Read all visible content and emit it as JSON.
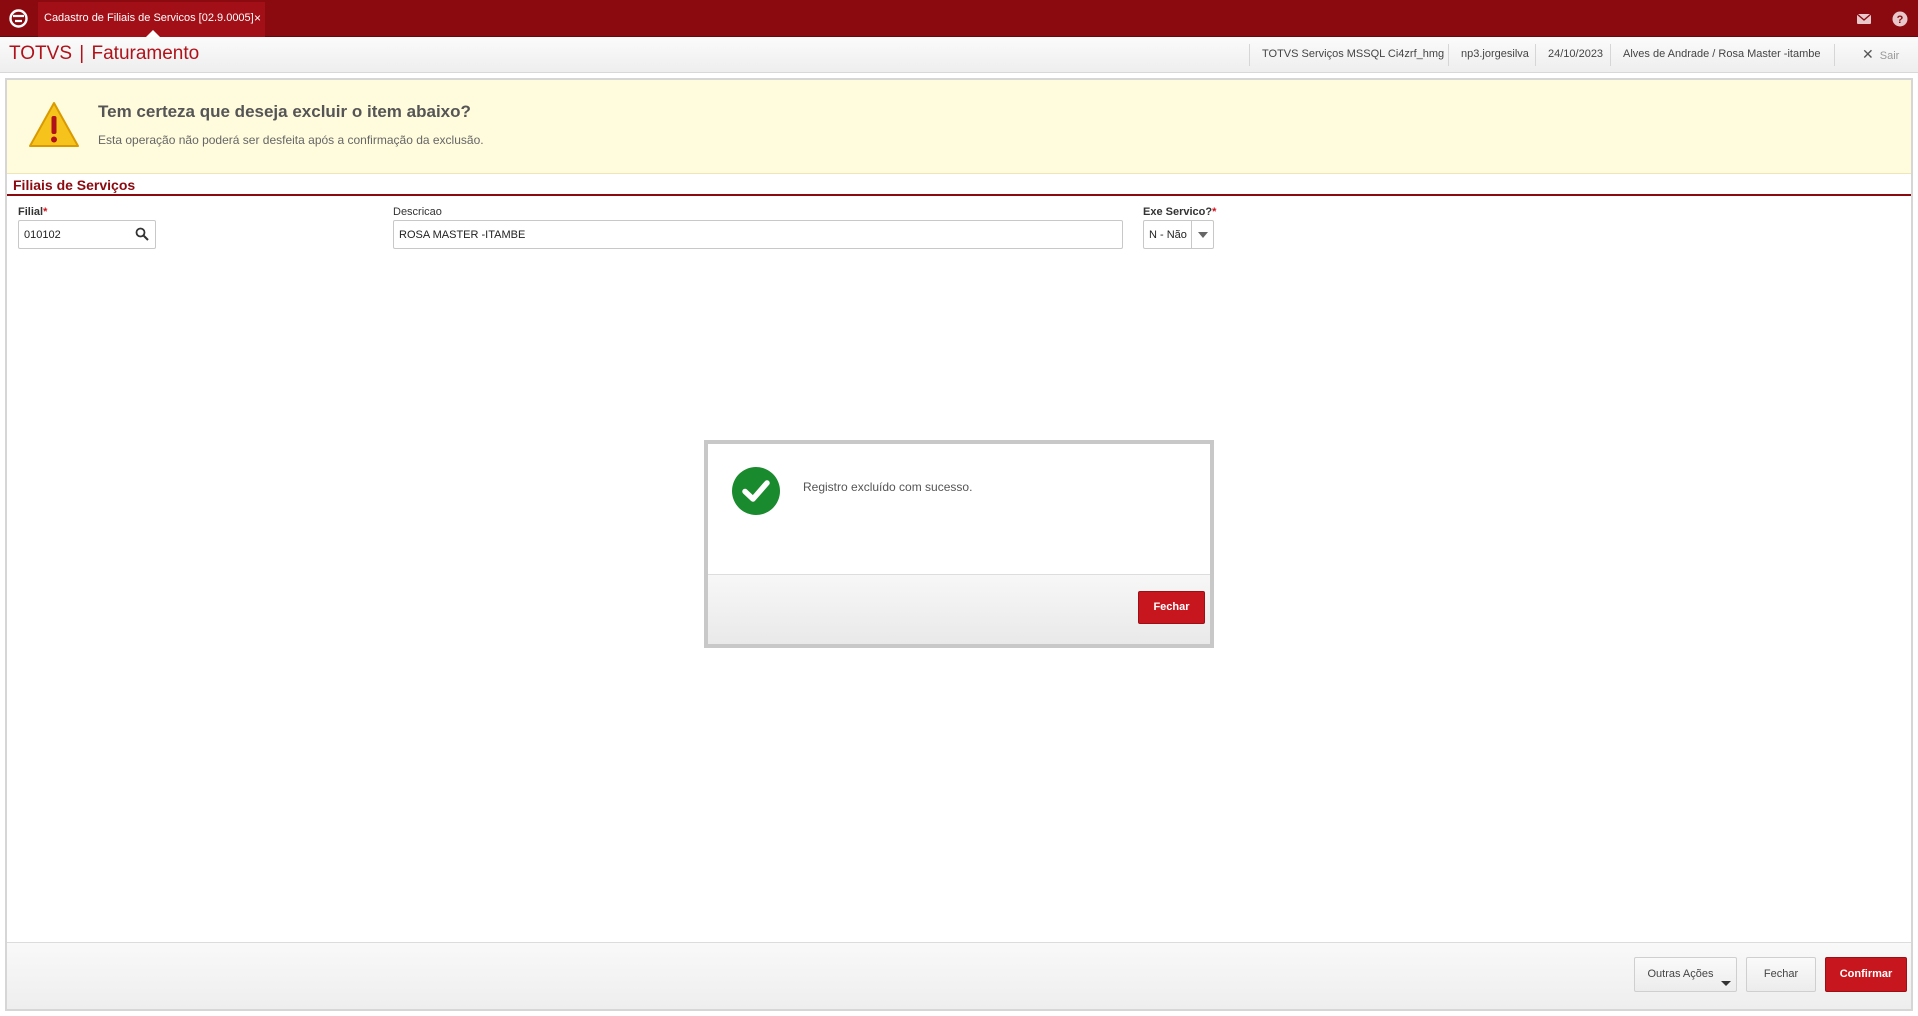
{
  "topbar": {
    "tab_label": "Cadastro de Filiais de Servicos [02.9.0005]",
    "tab_close": "×",
    "icons": [
      "totvs-logo-icon",
      "mail-icon",
      "help-icon"
    ]
  },
  "header": {
    "app_name": "TOTVS",
    "app_separator": "|",
    "module": "Faturamento",
    "environment": "TOTVS Serviços MSSQL Ci4zrf_hmg",
    "user": "np3.jorgesilva",
    "date": "24/10/2023",
    "branch": "Alves de Andrade / Rosa Master -itambe",
    "exit_label": "Sair",
    "exit_icon": "✕"
  },
  "warning": {
    "title": "Tem certeza que deseja excluir o item abaixo?",
    "subtitle": "Esta operação não poderá ser desfeita após a confirmação da exclusão.",
    "color": "#fffbdd"
  },
  "form": {
    "section_title": "Filiais de Serviços",
    "filial_label": "Filial",
    "filial_value": "010102",
    "descricao_label": "Descricao",
    "descricao_value": "ROSA MASTER -ITAMBE",
    "exe_servico_label": "Exe Servico?",
    "exe_servico_value": "N - Não",
    "required_mark": "*"
  },
  "modal": {
    "message": "Registro excluído com sucesso.",
    "close_label": "Fechar"
  },
  "footer": {
    "other_actions_label": "Outras Ações",
    "close_label": "Fechar",
    "confirm_label": "Confirmar"
  },
  "colors": {
    "brand": "#8b0a10",
    "accent_red": "#c8161e",
    "success": "#1a8a2e"
  }
}
